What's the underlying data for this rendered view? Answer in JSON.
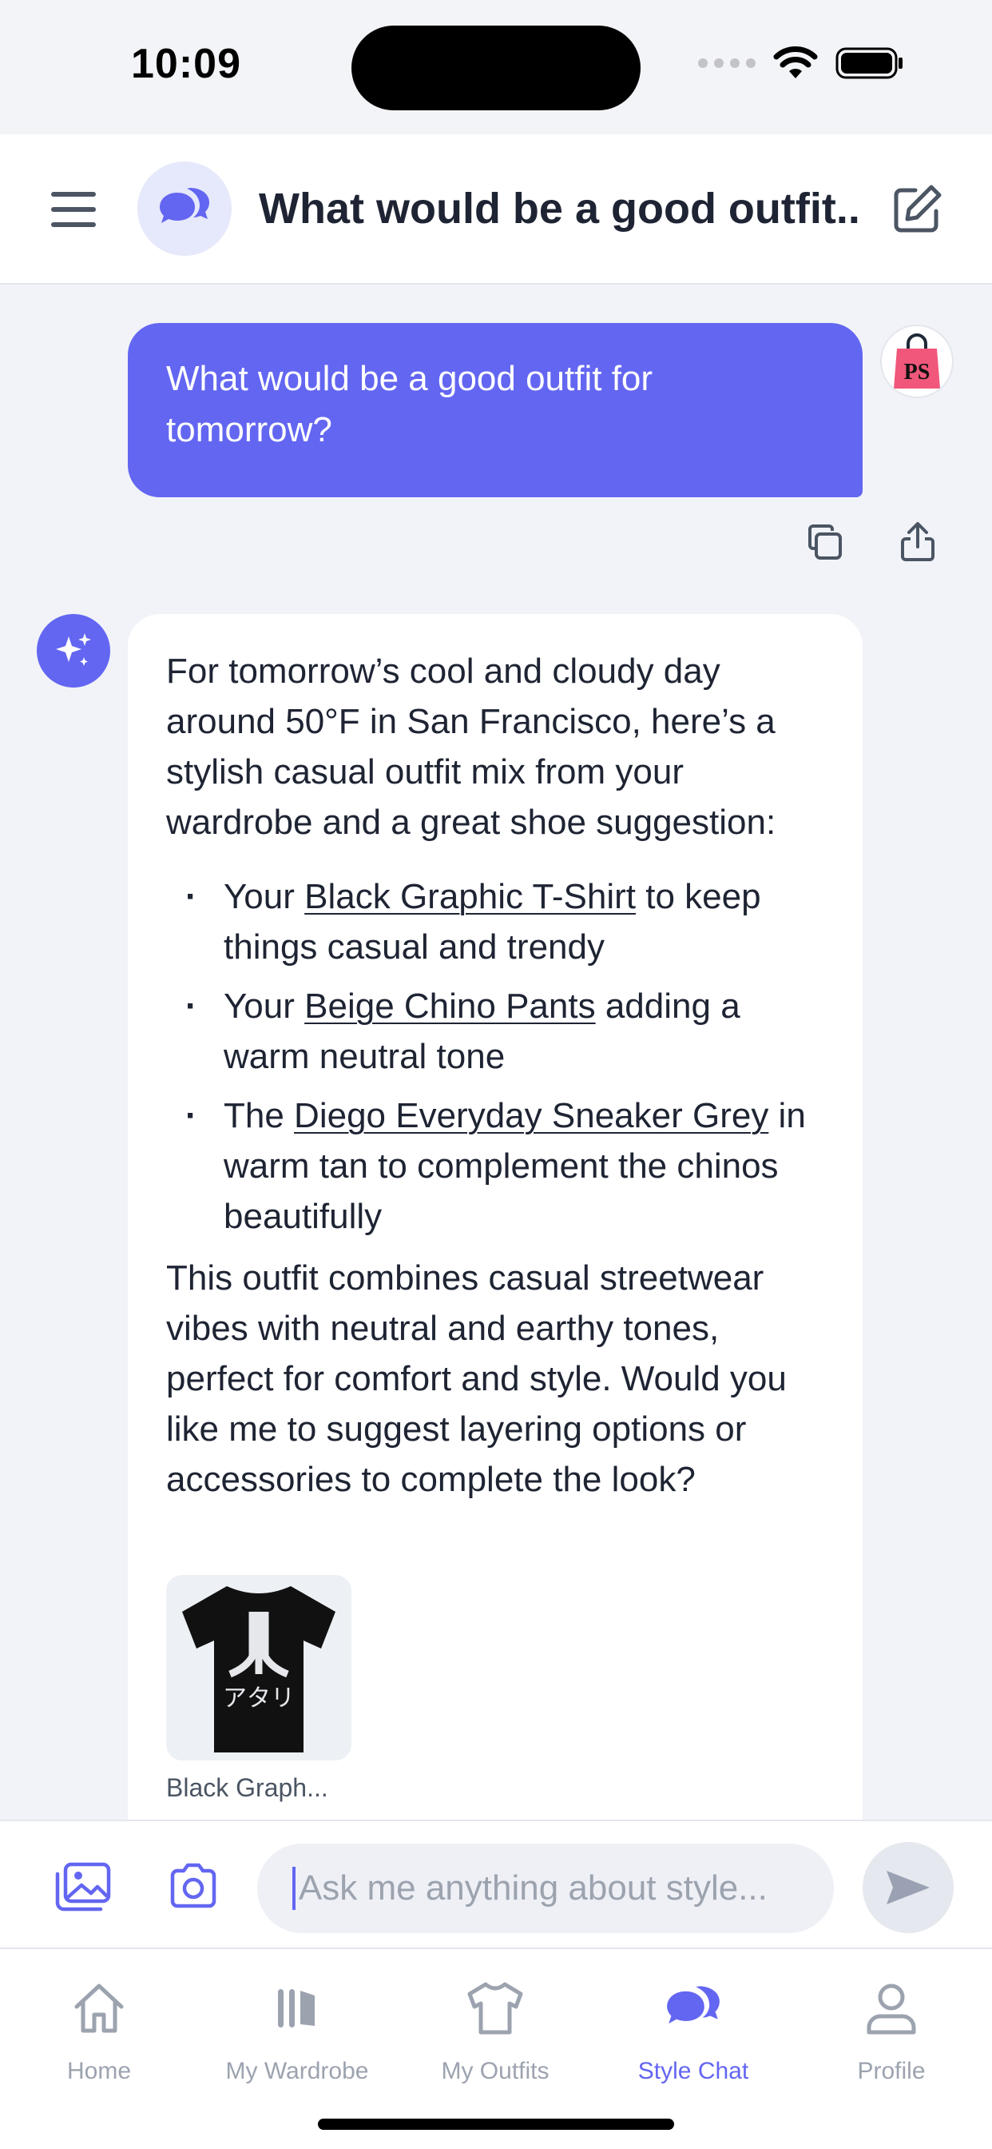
{
  "status_bar": {
    "time": "10:09"
  },
  "header": {
    "title": "What would be a good outfit...",
    "icons": [
      "menu-icon",
      "chat-bubble-icon",
      "new-chat-icon"
    ]
  },
  "user_message": {
    "text": "What would be a good outfit for tomorrow?",
    "avatar_text": "PS"
  },
  "assistant_message": {
    "intro": "For tomorrow’s cool and cloudy day around 50°F in San Francisco, here’s a stylish casual outfit mix from your wardrobe and a great shoe suggestion:",
    "bullets": [
      {
        "prefix": "Your ",
        "link": "Black Graphic T-Shirt",
        "suffix": " to keep things casual and trendy"
      },
      {
        "prefix": "Your ",
        "link": "Beige Chino Pants",
        "suffix": " adding a warm neutral tone"
      },
      {
        "prefix": "The ",
        "link": "Diego Everyday Sneaker Grey",
        "suffix": " in warm tan to complement the chinos beautifully"
      }
    ],
    "outro": "This outfit combines casual streetwear vibes with neutral and earthy tones, perfect for comfort and style. Would you like me to suggest layering options or accessories to complete the look?",
    "product": {
      "caption": "Black Graph...",
      "shirt_text": "アタリ"
    }
  },
  "composer": {
    "placeholder": "Ask me anything about style...",
    "value": ""
  },
  "tabs": [
    {
      "label": "Home",
      "icon": "home-icon",
      "active": false
    },
    {
      "label": "My Wardrobe",
      "icon": "wardrobe-icon",
      "active": false
    },
    {
      "label": "My Outfits",
      "icon": "tshirt-icon",
      "active": false
    },
    {
      "label": "Style Chat",
      "icon": "chat-bubble-icon",
      "active": true
    },
    {
      "label": "Profile",
      "icon": "profile-icon",
      "active": false
    }
  ],
  "colors": {
    "accent": "#6366f1",
    "background": "#f1f3f8",
    "text": "#1e2433",
    "muted": "#9ca3af"
  }
}
